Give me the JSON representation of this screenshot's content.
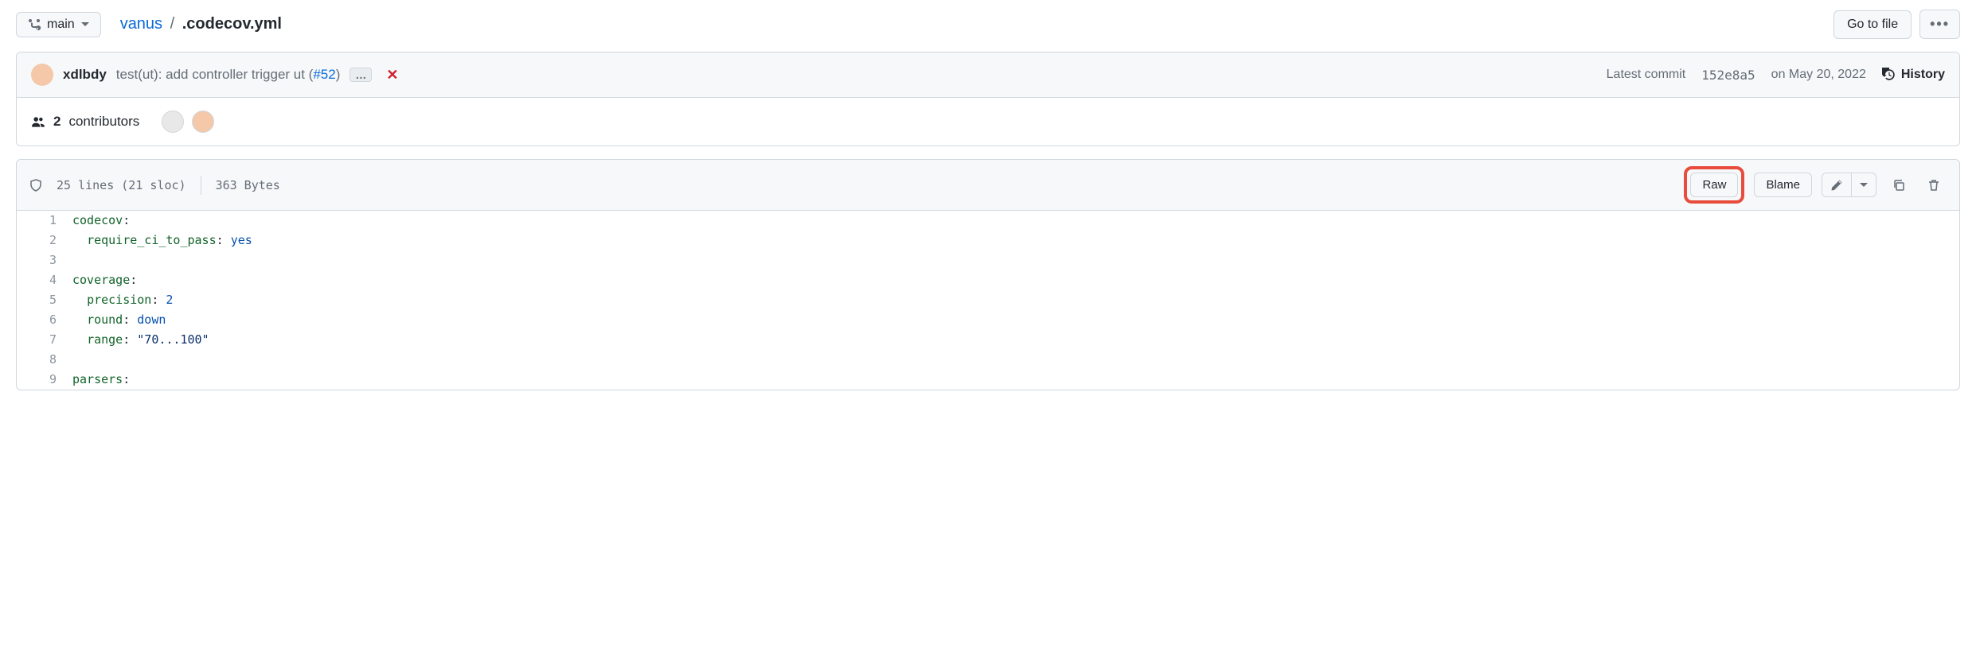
{
  "branch": {
    "label": "main"
  },
  "breadcrumb": {
    "repo": "vanus",
    "sep": "/",
    "file": ".codecov.yml"
  },
  "go_to_file": "Go to file",
  "commit": {
    "author": "xdlbdy",
    "message_prefix": "test(ut): add controller trigger ut (",
    "pr": "#52",
    "message_suffix": ")",
    "ellipsis": "…",
    "status_icon": "✕",
    "latest_label": "Latest commit",
    "sha": "152e8a5",
    "date": "on May 20, 2022",
    "history": "History"
  },
  "contributors": {
    "count": "2",
    "label": "contributors"
  },
  "file_stats": {
    "lines": "25 lines (21 sloc)",
    "bytes": "363 Bytes"
  },
  "actions": {
    "raw": "Raw",
    "blame": "Blame"
  },
  "code_lines": [
    {
      "n": "1",
      "tokens": [
        {
          "t": "key",
          "v": "codecov"
        },
        {
          "t": "plain",
          "v": ":"
        }
      ]
    },
    {
      "n": "2",
      "tokens": [
        {
          "t": "plain",
          "v": "  "
        },
        {
          "t": "key",
          "v": "require_ci_to_pass"
        },
        {
          "t": "plain",
          "v": ": "
        },
        {
          "t": "val",
          "v": "yes"
        }
      ]
    },
    {
      "n": "3",
      "tokens": []
    },
    {
      "n": "4",
      "tokens": [
        {
          "t": "key",
          "v": "coverage"
        },
        {
          "t": "plain",
          "v": ":"
        }
      ]
    },
    {
      "n": "5",
      "tokens": [
        {
          "t": "plain",
          "v": "  "
        },
        {
          "t": "key",
          "v": "precision"
        },
        {
          "t": "plain",
          "v": ": "
        },
        {
          "t": "val",
          "v": "2"
        }
      ]
    },
    {
      "n": "6",
      "tokens": [
        {
          "t": "plain",
          "v": "  "
        },
        {
          "t": "key",
          "v": "round"
        },
        {
          "t": "plain",
          "v": ": "
        },
        {
          "t": "val",
          "v": "down"
        }
      ]
    },
    {
      "n": "7",
      "tokens": [
        {
          "t": "plain",
          "v": "  "
        },
        {
          "t": "key",
          "v": "range"
        },
        {
          "t": "plain",
          "v": ": "
        },
        {
          "t": "str",
          "v": "\"70...100\""
        }
      ]
    },
    {
      "n": "8",
      "tokens": []
    },
    {
      "n": "9",
      "tokens": [
        {
          "t": "key",
          "v": "parsers"
        },
        {
          "t": "plain",
          "v": ":"
        }
      ]
    }
  ]
}
